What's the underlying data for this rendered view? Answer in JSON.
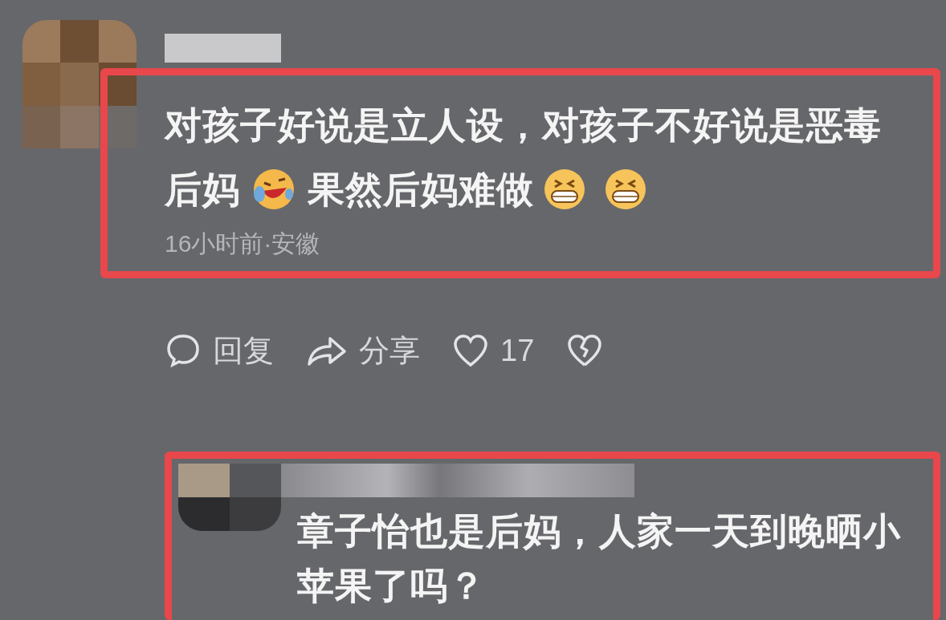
{
  "comments": [
    {
      "content": [
        {
          "kind": "text",
          "text": "对孩子好说是立人设，对孩子不好说是恶毒"
        },
        {
          "kind": "text",
          "text": "后妈"
        },
        {
          "kind": "laugh_cry"
        },
        {
          "kind": "text",
          "text": "果然后妈难做"
        },
        {
          "kind": "grin"
        },
        {
          "kind": "grin"
        }
      ],
      "meta": "16小时前·安徽",
      "actions": [
        {
          "kind": "reply",
          "label": "回复"
        },
        {
          "kind": "share",
          "label": "分享"
        },
        {
          "kind": "like",
          "label": "17"
        },
        {
          "kind": "dislike"
        }
      ]
    },
    {
      "content": [
        {
          "kind": "text",
          "text": "章子怡也是后妈，人家一天到晚晒小"
        },
        {
          "kind": "text",
          "text": "苹果了吗？"
        }
      ]
    }
  ]
}
